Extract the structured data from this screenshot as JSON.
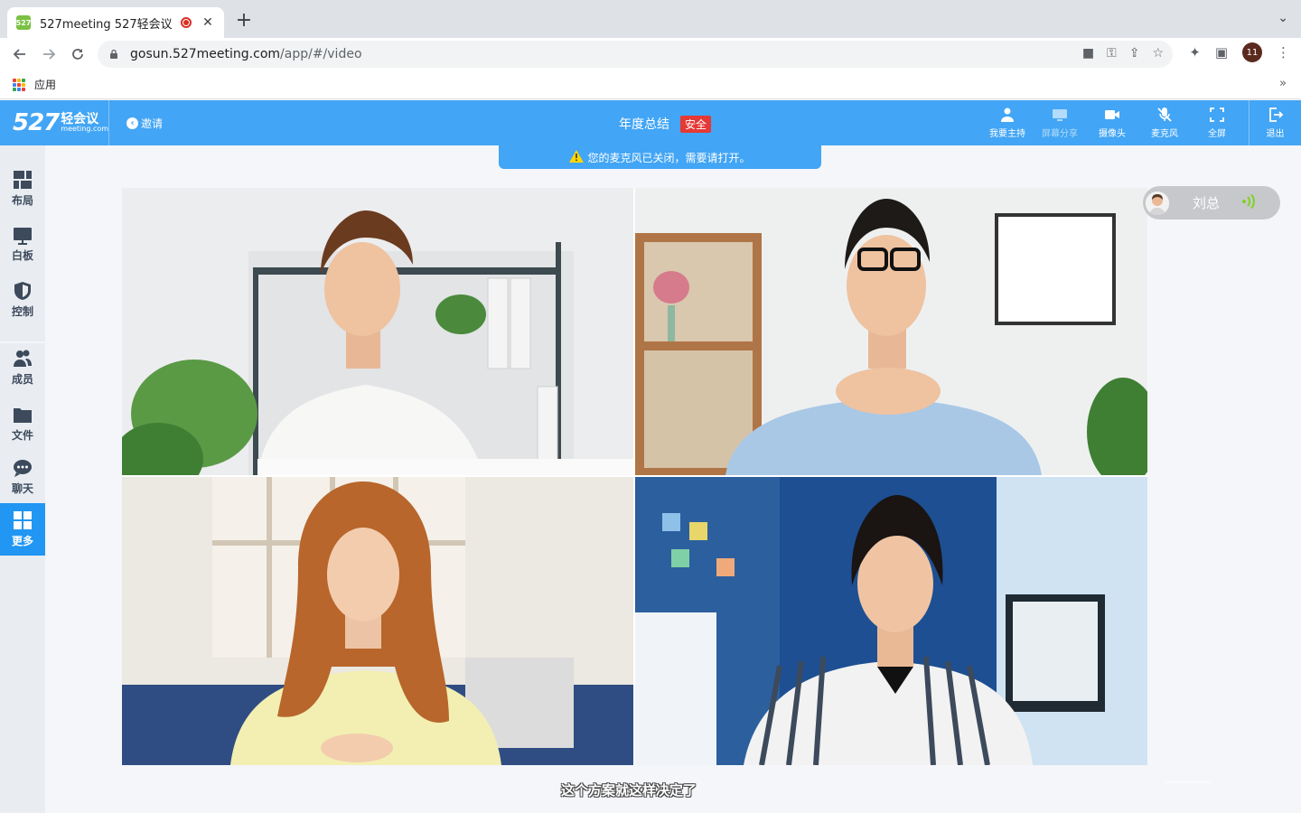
{
  "browser": {
    "tab_title": "527meeting 527轻会议",
    "favicon_text": "527",
    "url_host": "gosun.527meeting.com",
    "url_path": "/app/#/video",
    "profile_initials": "11",
    "bookmark_apps": "应用",
    "colors": {
      "tab_bg": "#dee1e6",
      "favicon": "#7ac142",
      "recording": "#d93025"
    }
  },
  "header": {
    "logo_number": "527",
    "logo_cn": "轻会议",
    "logo_en": "meeting.com",
    "invite_label": "邀请",
    "meeting_title": "年度总结",
    "secure_badge": "安全",
    "actions": [
      {
        "label": "我要主持",
        "icon": "host-icon",
        "enabled": true
      },
      {
        "label": "屏幕分享",
        "icon": "screen-share-icon",
        "enabled": false
      },
      {
        "label": "摄像头",
        "icon": "camera-icon",
        "enabled": true
      },
      {
        "label": "麦克风",
        "icon": "microphone-muted-icon",
        "enabled": true
      },
      {
        "label": "全屏",
        "icon": "fullscreen-icon",
        "enabled": true
      },
      {
        "label": "退出",
        "icon": "exit-icon",
        "enabled": true
      }
    ],
    "colors": {
      "primary": "#42a5f5",
      "secure": "#e53935"
    }
  },
  "notice": {
    "text": "您的麦克风已关闭，需要请打开。",
    "icon": "warning-icon"
  },
  "sidebar": {
    "items": [
      {
        "label": "布局",
        "icon": "layout-icon"
      },
      {
        "label": "白板",
        "icon": "whiteboard-icon"
      },
      {
        "label": "控制",
        "icon": "shield-icon"
      },
      {
        "label": "成员",
        "icon": "members-icon"
      },
      {
        "label": "文件",
        "icon": "folder-icon"
      },
      {
        "label": "聊天",
        "icon": "chat-icon"
      },
      {
        "label": "更多",
        "icon": "grid-icon",
        "active": true
      }
    ],
    "colors": {
      "bg": "#e9ecf1",
      "active": "#2196f3"
    }
  },
  "speaker": {
    "name": "刘总",
    "icon": "volume-icon"
  },
  "subtitle": "这个方案就这样决定了"
}
